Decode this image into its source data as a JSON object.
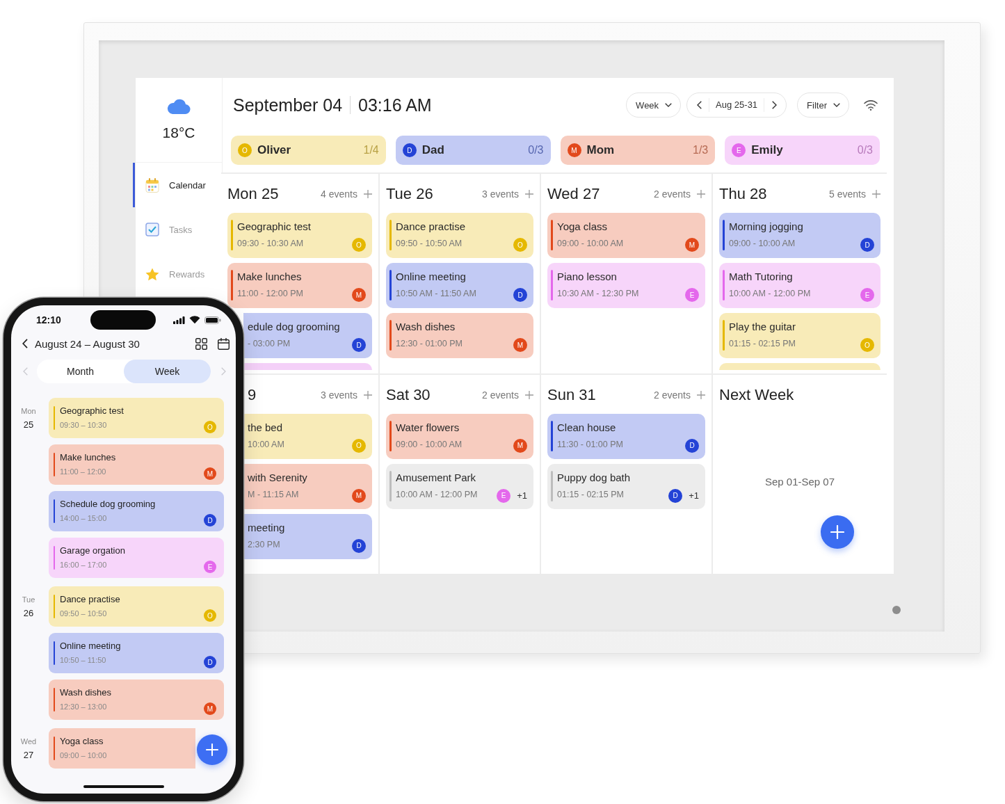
{
  "frame": {
    "sidebar": {
      "temperature": "18°C",
      "items": [
        {
          "label": "Calendar",
          "selected": true
        },
        {
          "label": "Tasks",
          "selected": false
        },
        {
          "label": "Rewards",
          "selected": false
        }
      ]
    },
    "header": {
      "date": "September 04",
      "time": "03:16 AM",
      "view": "Week",
      "range": "Aug 25-31",
      "filter": "Filter"
    },
    "members": [
      {
        "initial": "O",
        "name": "Oliver",
        "progress": "1/4",
        "color": "#e5b800"
      },
      {
        "initial": "D",
        "name": "Dad",
        "progress": "0/3",
        "color": "#2443d6"
      },
      {
        "initial": "M",
        "name": "Mom",
        "progress": "1/3",
        "color": "#e2491b"
      },
      {
        "initial": "E",
        "name": "Emily",
        "progress": "0/3",
        "color": "#e468ec"
      }
    ],
    "days": [
      {
        "title": "Mon 25",
        "count": "4 events",
        "events": [
          {
            "kind": "single",
            "title": "Geographic test",
            "time": "09:30 - 10:30 AM",
            "avatar": "O",
            "color": "#e5b800"
          },
          {
            "kind": "single",
            "title": "Make lunches",
            "time": "11:00 - 12:00 PM",
            "avatar": "M",
            "color": "#e2491b"
          },
          {
            "kind": "single",
            "title": "edule dog grooming",
            "time": "- 03:00 PM",
            "avatar": "D",
            "color": "#2443d6"
          },
          {
            "kind": "peek",
            "color": "#f4d0f8"
          }
        ]
      },
      {
        "title": "Tue 26",
        "count": "3 events",
        "events": [
          {
            "kind": "single",
            "title": "Dance practise",
            "time": "09:50 - 10:50 AM",
            "avatar": "O",
            "color": "#e5b800"
          },
          {
            "kind": "single",
            "title": "Online meeting",
            "time": "10:50 AM - 11:50 AM",
            "avatar": "D",
            "color": "#2443d6"
          },
          {
            "kind": "single",
            "title": "Wash dishes",
            "time": "12:30 - 01:00 PM",
            "avatar": "M",
            "color": "#e2491b"
          }
        ]
      },
      {
        "title": "Wed 27",
        "count": "2 events",
        "events": [
          {
            "kind": "single",
            "title": "Yoga class",
            "time": "09:00 - 10:00 AM",
            "avatar": "M",
            "color": "#e2491b"
          },
          {
            "kind": "single",
            "title": "Piano lesson",
            "time": "10:30 AM - 12:30 PM",
            "avatar": "E",
            "color": "#e468ec"
          }
        ]
      },
      {
        "title": "Thu 28",
        "count": "5 events",
        "events": [
          {
            "kind": "single",
            "title": "Morning jogging",
            "time": "09:00 - 10:00 AM",
            "avatar": "D",
            "color": "#2443d6"
          },
          {
            "kind": "single",
            "title": "Math Tutoring",
            "time": "10:00 AM - 12:00 PM",
            "avatar": "E",
            "color": "#e468ec"
          },
          {
            "kind": "single",
            "title": "Play the guitar",
            "time": "01:15 - 02:15 PM",
            "avatar": "O",
            "color": "#e5b800"
          },
          {
            "kind": "peek",
            "color": "#f8ebb8"
          }
        ]
      },
      {
        "title": "9",
        "count": "3 events",
        "events": [
          {
            "kind": "single",
            "title": "the bed",
            "time": "10:00 AM",
            "avatar": "O",
            "color": "#e5b800"
          },
          {
            "kind": "single",
            "title": "with Serenity",
            "time": "M - 11:15 AM",
            "avatar": "M",
            "color": "#e2491b"
          },
          {
            "kind": "single",
            "title": "meeting",
            "time": "2:30 PM",
            "avatar": "D",
            "color": "#2443d6"
          }
        ]
      },
      {
        "title": "Sat 30",
        "count": "2 events",
        "events": [
          {
            "kind": "single",
            "title": "Water flowers",
            "time": "09:00 - 10:00 AM",
            "avatar": "M",
            "color": "#e2491b"
          },
          {
            "kind": "group",
            "title": "Amusement Park",
            "time": "10:00 AM - 12:00 PM",
            "avatar": "E",
            "color": "#e468ec",
            "extra": "+1"
          }
        ]
      },
      {
        "title": "Sun 31",
        "count": "2 events",
        "events": [
          {
            "kind": "single",
            "title": "Clean house",
            "time": "11:30 - 01:00 PM",
            "avatar": "D",
            "color": "#2443d6"
          },
          {
            "kind": "group",
            "title": "Puppy dog bath",
            "time": "01:15 - 02:15 PM",
            "avatar": "D",
            "color": "#2443d6",
            "extra": "+1"
          }
        ]
      }
    ],
    "next_week": {
      "title": "Next Week",
      "range": "Sep 01-Sep 07"
    }
  },
  "phone": {
    "status_time": "12:10",
    "title": "August 24 – August 30",
    "tabs": [
      {
        "label": "Month",
        "selected": false
      },
      {
        "label": "Week",
        "selected": true
      }
    ],
    "days": [
      {
        "weekday": "Mon",
        "day": "25",
        "events": [
          {
            "title": "Geographic test",
            "time": "09:30 – 10:30",
            "avatar": "O",
            "color": "#e5b800"
          },
          {
            "title": "Make lunches",
            "time": "11:00 – 12:00",
            "avatar": "M",
            "color": "#e2491b"
          },
          {
            "title": "Schedule dog grooming",
            "time": "14:00 – 15:00",
            "avatar": "D",
            "color": "#2443d6"
          },
          {
            "title": "Garage orgation",
            "time": "16:00 – 17:00",
            "avatar": "E",
            "color": "#e468ec"
          }
        ]
      },
      {
        "weekday": "Tue",
        "day": "26",
        "events": [
          {
            "title": "Dance practise",
            "time": "09:50 – 10:50",
            "avatar": "O",
            "color": "#e5b800"
          },
          {
            "title": "Online meeting",
            "time": "10:50 – 11:50",
            "avatar": "D",
            "color": "#2443d6"
          },
          {
            "title": "Wash dishes",
            "time": "12:30 – 13:00",
            "avatar": "M",
            "color": "#e2491b"
          }
        ]
      },
      {
        "weekday": "Wed",
        "day": "27",
        "events": [
          {
            "title": "Yoga class",
            "time": "09:00 – 10:00",
            "color": "#e2491b"
          }
        ]
      }
    ]
  }
}
